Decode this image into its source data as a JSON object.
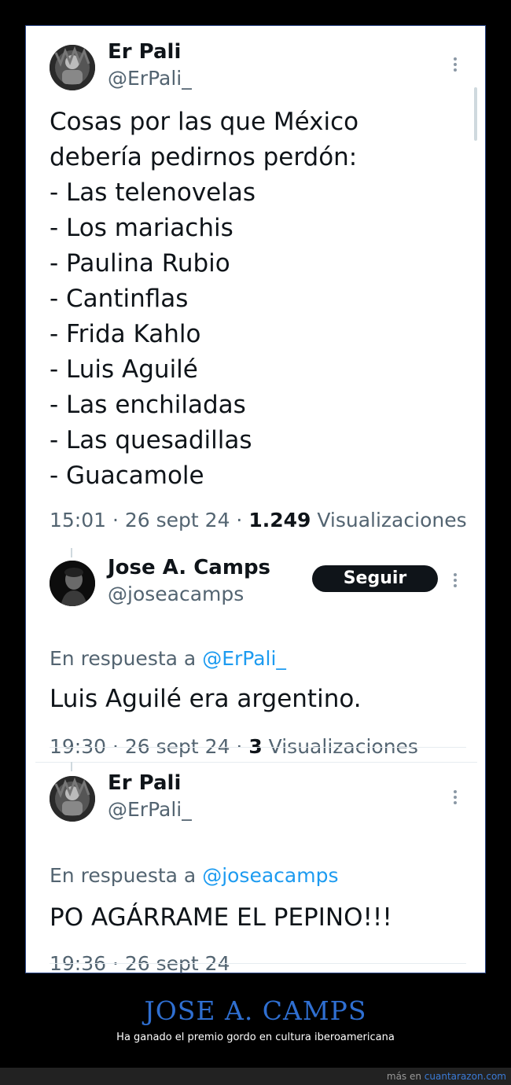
{
  "tweets": [
    {
      "name": "Er Pali",
      "handle": "@ErPali_",
      "lines": [
        "Cosas por las que México",
        "debería pedirnos perdón:",
        "- Las telenovelas",
        "- Los mariachis",
        "- Paulina Rubio",
        "- Cantinflas",
        "- Frida Kahlo",
        "- Luis Aguilé",
        "- Las enchiladas",
        "- Las quesadillas",
        "- Guacamole"
      ],
      "time": "15:01 · 26 sept 24 · ",
      "views_count": "1.249",
      "views_label": " Visualizaciones"
    },
    {
      "name": "Jose A. Camps",
      "handle": "@joseacamps",
      "follow_label": "Seguir",
      "reply_prefix": "En respuesta a ",
      "reply_handle": "@ErPali_",
      "text": "Luis Aguilé era argentino.",
      "time": "19:30 · 26 sept 24 · ",
      "views_count": "3",
      "views_label": " Visualizaciones"
    },
    {
      "name": "Er Pali",
      "handle": "@ErPali_",
      "reply_prefix": "En respuesta a ",
      "reply_handle": "@joseacamps",
      "text": "PO AGÁRRAME EL PEPINO!!!",
      "time": "19:36 · 26 sept 24"
    }
  ],
  "caption": {
    "title": "JOSE A. CAMPS",
    "subtitle": "Ha ganado el premio gordo en cultura iberoamericana"
  },
  "footer": {
    "prefix": "más en ",
    "site": "cuantarazon.com"
  },
  "colors": {
    "link": "#1d9bf0",
    "caption_title": "#2f6fd1"
  }
}
